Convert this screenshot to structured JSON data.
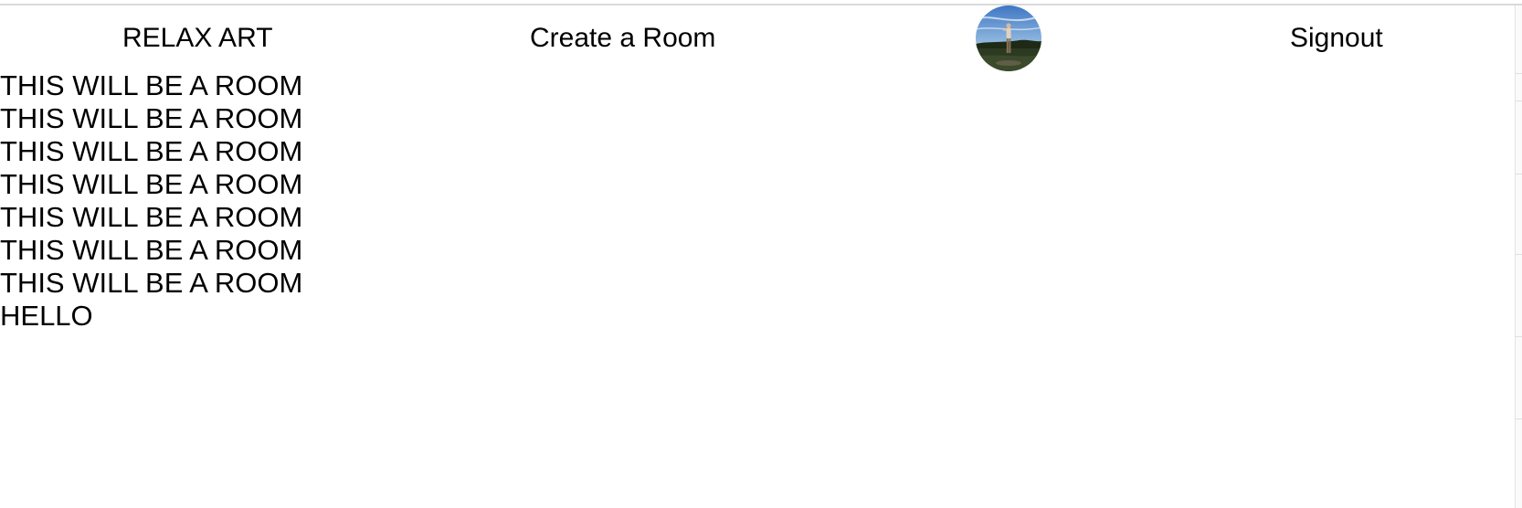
{
  "navbar": {
    "brand": "RELAX ART",
    "create_room": "Create a Room",
    "avatar_icon": "user-avatar",
    "signout": "Signout"
  },
  "rooms": [
    "THIS WILL BE A ROOM",
    "THIS WILL BE A ROOM",
    "THIS WILL BE A ROOM",
    "THIS WILL BE A ROOM",
    "THIS WILL BE A ROOM",
    "THIS WILL BE A ROOM",
    "THIS WILL BE A ROOM",
    "HELLO"
  ],
  "colors": {
    "text": "#000000",
    "background": "#ffffff"
  }
}
